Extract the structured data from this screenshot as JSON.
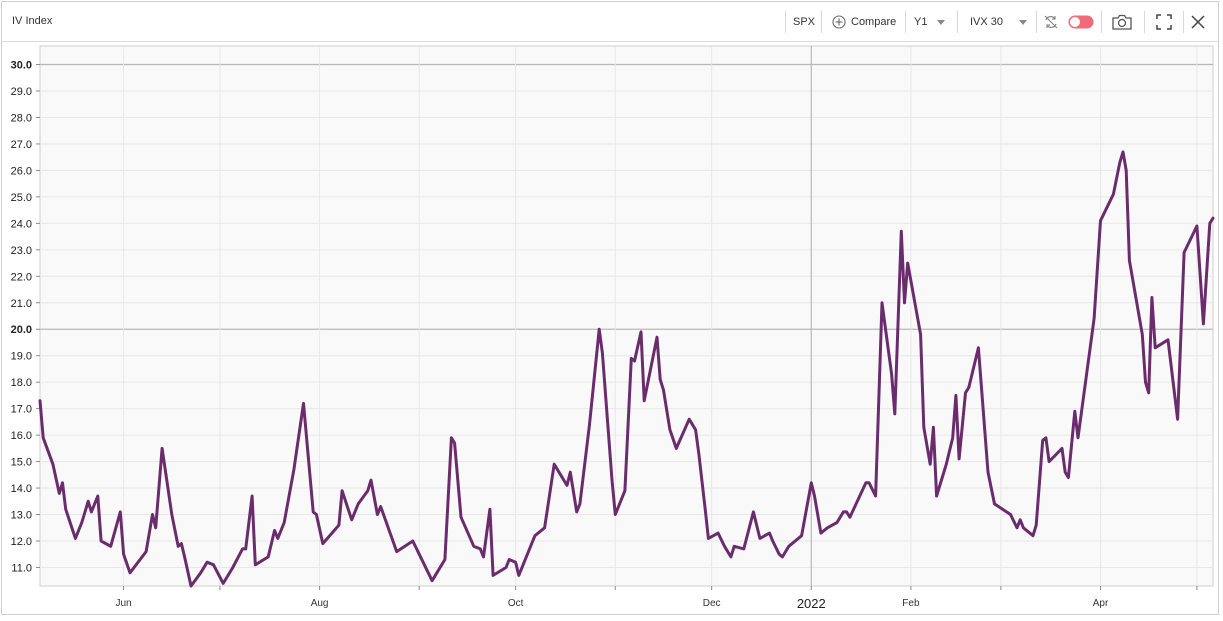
{
  "toolbar": {
    "title": "IV Index",
    "symbol": "SPX",
    "compare_label": "Compare",
    "period": "Y1",
    "measure": "IVX 30"
  },
  "colors": {
    "line": "#6b2c6e",
    "accent_toggle": "#f06a7a"
  },
  "chart_data": {
    "type": "line",
    "title": "IV Index",
    "xlabel": "",
    "ylabel": "",
    "ylim": [
      10.3,
      30.7
    ],
    "ytick_labels": [
      "11.0",
      "12.0",
      "13.0",
      "14.0",
      "15.0",
      "16.0",
      "17.0",
      "18.0",
      "19.0",
      "20.0",
      "21.0",
      "22.0",
      "23.0",
      "24.0",
      "25.0",
      "26.0",
      "27.0",
      "28.0",
      "29.0",
      "30.0"
    ],
    "major_ticks": [
      "20.0",
      "30.0"
    ],
    "xtick_labels": [
      {
        "label": "Jun",
        "date": "2021-06-01"
      },
      {
        "label": "Aug",
        "date": "2021-08-01"
      },
      {
        "label": "Oct",
        "date": "2021-10-01"
      },
      {
        "label": "Dec",
        "date": "2021-12-01"
      },
      {
        "label": "2022",
        "date": "2022-01-01",
        "major": true
      },
      {
        "label": "Feb",
        "date": "2022-02-01"
      },
      {
        "label": "Apr",
        "date": "2022-04-01"
      }
    ],
    "minor_ticks": [
      "2021-07-01",
      "2021-09-01",
      "2021-11-01",
      "2022-03-01",
      "2022-05-01"
    ],
    "xrange": [
      "2021-05-06",
      "2022-05-06"
    ],
    "grid": true,
    "series": [
      {
        "points": [
          [
            "2021-05-06",
            17.3
          ],
          [
            "2021-05-07",
            15.9
          ],
          [
            "2021-05-10",
            14.9
          ],
          [
            "2021-05-12",
            13.8
          ],
          [
            "2021-05-13",
            14.2
          ],
          [
            "2021-05-14",
            13.2
          ],
          [
            "2021-05-17",
            12.1
          ],
          [
            "2021-05-19",
            12.7
          ],
          [
            "2021-05-21",
            13.5
          ],
          [
            "2021-05-22",
            13.1
          ],
          [
            "2021-05-24",
            13.7
          ],
          [
            "2021-05-25",
            12.0
          ],
          [
            "2021-05-28",
            11.8
          ],
          [
            "2021-05-31",
            13.1
          ],
          [
            "2021-06-01",
            11.5
          ],
          [
            "2021-06-03",
            10.8
          ],
          [
            "2021-06-08",
            11.6
          ],
          [
            "2021-06-10",
            13.0
          ],
          [
            "2021-06-11",
            12.5
          ],
          [
            "2021-06-13",
            15.5
          ],
          [
            "2021-06-16",
            13.0
          ],
          [
            "2021-06-18",
            11.8
          ],
          [
            "2021-06-19",
            11.9
          ],
          [
            "2021-06-20",
            11.4
          ],
          [
            "2021-06-22",
            10.3
          ],
          [
            "2021-06-25",
            10.8
          ],
          [
            "2021-06-27",
            11.2
          ],
          [
            "2021-06-29",
            11.1
          ],
          [
            "2021-07-02",
            10.4
          ],
          [
            "2021-07-05",
            11.0
          ],
          [
            "2021-07-08",
            11.7
          ],
          [
            "2021-07-09",
            11.7
          ],
          [
            "2021-07-11",
            13.7
          ],
          [
            "2021-07-12",
            11.1
          ],
          [
            "2021-07-16",
            11.4
          ],
          [
            "2021-07-18",
            12.4
          ],
          [
            "2021-07-19",
            12.1
          ],
          [
            "2021-07-21",
            12.7
          ],
          [
            "2021-07-24",
            14.7
          ],
          [
            "2021-07-27",
            17.2
          ],
          [
            "2021-07-30",
            13.1
          ],
          [
            "2021-07-31",
            13.0
          ],
          [
            "2021-08-02",
            11.9
          ],
          [
            "2021-08-07",
            12.6
          ],
          [
            "2021-08-08",
            13.9
          ],
          [
            "2021-08-11",
            12.8
          ],
          [
            "2021-08-13",
            13.4
          ],
          [
            "2021-08-16",
            13.9
          ],
          [
            "2021-08-17",
            14.3
          ],
          [
            "2021-08-19",
            13.0
          ],
          [
            "2021-08-20",
            13.3
          ],
          [
            "2021-08-25",
            11.6
          ],
          [
            "2021-08-30",
            12.0
          ],
          [
            "2021-09-05",
            10.5
          ],
          [
            "2021-09-09",
            11.3
          ],
          [
            "2021-09-11",
            15.9
          ],
          [
            "2021-09-12",
            15.7
          ],
          [
            "2021-09-14",
            12.9
          ],
          [
            "2021-09-18",
            11.8
          ],
          [
            "2021-09-20",
            11.7
          ],
          [
            "2021-09-21",
            11.4
          ],
          [
            "2021-09-23",
            13.2
          ],
          [
            "2021-09-24",
            10.7
          ],
          [
            "2021-09-28",
            11.0
          ],
          [
            "2021-09-29",
            11.3
          ],
          [
            "2021-10-01",
            11.2
          ],
          [
            "2021-10-02",
            10.7
          ],
          [
            "2021-10-07",
            12.2
          ],
          [
            "2021-10-10",
            12.5
          ],
          [
            "2021-10-13",
            14.9
          ],
          [
            "2021-10-16",
            14.3
          ],
          [
            "2021-10-17",
            14.1
          ],
          [
            "2021-10-18",
            14.6
          ],
          [
            "2021-10-20",
            13.1
          ],
          [
            "2021-10-21",
            13.4
          ],
          [
            "2021-10-24",
            16.4
          ],
          [
            "2021-10-27",
            20.0
          ],
          [
            "2021-10-28",
            19.1
          ],
          [
            "2021-10-31",
            14.3
          ],
          [
            "2021-11-01",
            13.0
          ],
          [
            "2021-11-04",
            13.9
          ],
          [
            "2021-11-06",
            18.9
          ],
          [
            "2021-11-07",
            18.8
          ],
          [
            "2021-11-09",
            19.9
          ],
          [
            "2021-11-10",
            17.3
          ],
          [
            "2021-11-14",
            19.7
          ],
          [
            "2021-11-15",
            18.1
          ],
          [
            "2021-11-16",
            17.7
          ],
          [
            "2021-11-18",
            16.2
          ],
          [
            "2021-11-20",
            15.5
          ],
          [
            "2021-11-24",
            16.6
          ],
          [
            "2021-11-26",
            16.2
          ],
          [
            "2021-11-27",
            15.3
          ],
          [
            "2021-11-29",
            13.2
          ],
          [
            "2021-11-30",
            12.1
          ],
          [
            "2021-12-03",
            12.3
          ],
          [
            "2021-12-05",
            11.8
          ],
          [
            "2021-12-07",
            11.4
          ],
          [
            "2021-12-08",
            11.8
          ],
          [
            "2021-12-11",
            11.7
          ],
          [
            "2021-12-14",
            13.1
          ],
          [
            "2021-12-16",
            12.1
          ],
          [
            "2021-12-19",
            12.3
          ],
          [
            "2021-12-20",
            12.0
          ],
          [
            "2021-12-22",
            11.5
          ],
          [
            "2021-12-23",
            11.4
          ],
          [
            "2021-12-25",
            11.8
          ],
          [
            "2021-12-29",
            12.2
          ],
          [
            "2022-01-01",
            14.2
          ],
          [
            "2022-01-02",
            13.7
          ],
          [
            "2022-01-04",
            12.3
          ],
          [
            "2022-01-06",
            12.5
          ],
          [
            "2022-01-09",
            12.7
          ],
          [
            "2022-01-11",
            13.1
          ],
          [
            "2022-01-12",
            13.1
          ],
          [
            "2022-01-13",
            12.9
          ],
          [
            "2022-01-18",
            14.2
          ],
          [
            "2022-01-19",
            14.2
          ],
          [
            "2022-01-21",
            13.7
          ],
          [
            "2022-01-23",
            21.0
          ],
          [
            "2022-01-26",
            18.3
          ],
          [
            "2022-01-27",
            16.8
          ],
          [
            "2022-01-29",
            23.7
          ],
          [
            "2022-01-30",
            21.0
          ],
          [
            "2022-01-31",
            22.5
          ],
          [
            "2022-02-04",
            19.8
          ],
          [
            "2022-02-05",
            16.3
          ],
          [
            "2022-02-07",
            14.9
          ],
          [
            "2022-02-08",
            16.3
          ],
          [
            "2022-02-09",
            13.7
          ],
          [
            "2022-02-12",
            14.9
          ],
          [
            "2022-02-14",
            15.9
          ],
          [
            "2022-02-15",
            17.5
          ],
          [
            "2022-02-16",
            15.1
          ],
          [
            "2022-02-18",
            17.6
          ],
          [
            "2022-02-19",
            17.8
          ],
          [
            "2022-02-22",
            19.3
          ],
          [
            "2022-02-25",
            14.6
          ],
          [
            "2022-02-27",
            13.4
          ],
          [
            "2022-03-04",
            13.0
          ],
          [
            "2022-03-06",
            12.5
          ],
          [
            "2022-03-07",
            12.8
          ],
          [
            "2022-03-08",
            12.5
          ],
          [
            "2022-03-11",
            12.2
          ],
          [
            "2022-03-12",
            12.6
          ],
          [
            "2022-03-14",
            15.8
          ],
          [
            "2022-03-15",
            15.9
          ],
          [
            "2022-03-16",
            15.0
          ],
          [
            "2022-03-20",
            15.5
          ],
          [
            "2022-03-21",
            14.6
          ],
          [
            "2022-03-22",
            14.4
          ],
          [
            "2022-03-24",
            16.9
          ],
          [
            "2022-03-25",
            15.9
          ],
          [
            "2022-03-30",
            20.4
          ],
          [
            "2022-04-01",
            24.1
          ],
          [
            "2022-04-05",
            25.1
          ],
          [
            "2022-04-07",
            26.3
          ],
          [
            "2022-04-08",
            26.7
          ],
          [
            "2022-04-09",
            26.0
          ],
          [
            "2022-04-10",
            22.6
          ],
          [
            "2022-04-14",
            19.8
          ],
          [
            "2022-04-15",
            18.0
          ],
          [
            "2022-04-16",
            17.6
          ],
          [
            "2022-04-17",
            21.2
          ],
          [
            "2022-04-18",
            19.3
          ],
          [
            "2022-04-22",
            19.6
          ],
          [
            "2022-04-25",
            16.6
          ],
          [
            "2022-04-27",
            22.9
          ],
          [
            "2022-05-01",
            23.9
          ],
          [
            "2022-05-03",
            20.2
          ],
          [
            "2022-05-05",
            24.0
          ],
          [
            "2022-05-06",
            24.2
          ]
        ]
      }
    ]
  }
}
